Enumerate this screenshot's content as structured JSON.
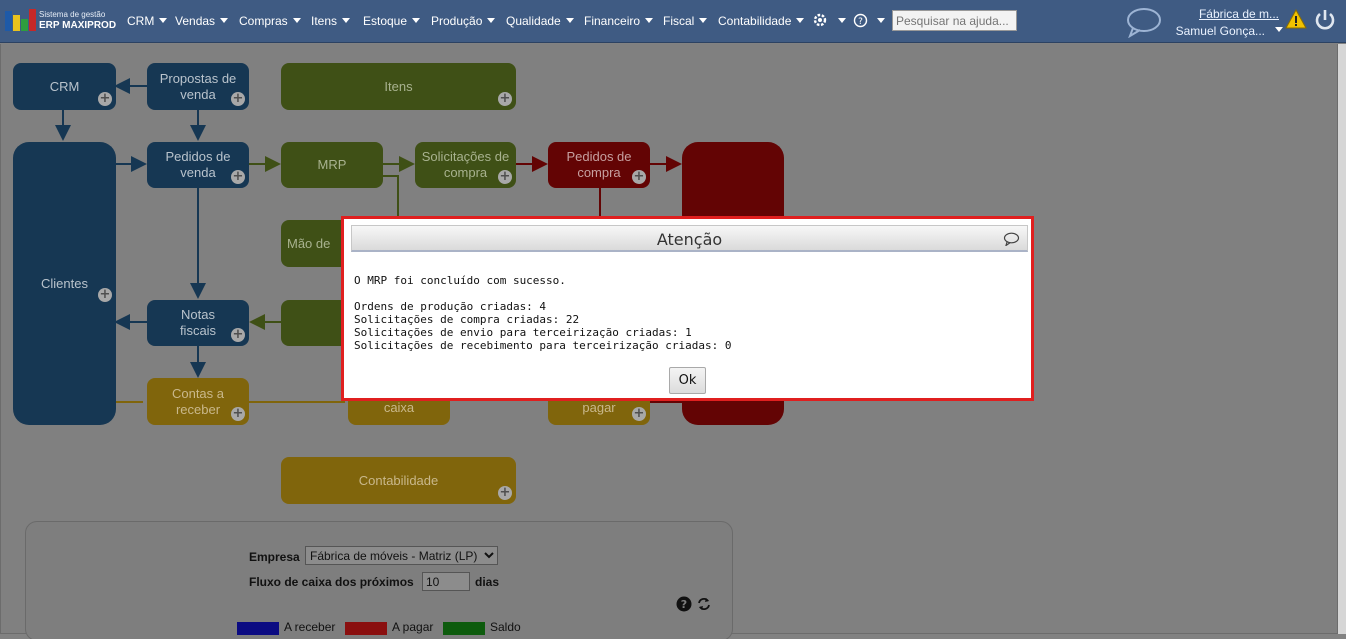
{
  "logo": {
    "line1": "Sistema de gestão",
    "line2": "ERP MAXIPROD"
  },
  "menu": [
    "CRM",
    "Vendas",
    "Compras",
    "Itens",
    "Estoque",
    "Produção",
    "Qualidade",
    "Financeiro",
    "Fiscal",
    "Contabilidade"
  ],
  "search": {
    "placeholder": "Pesquisar na ajuda..."
  },
  "user": {
    "company": "Fábrica de m...",
    "name": "Samuel Gonça..."
  },
  "nodes": {
    "crm": "CRM",
    "propostas": "Propostas de\nvenda",
    "itens": "Itens",
    "clientes": "Clientes",
    "pedidos_venda": "Pedidos de\nvenda",
    "mrp": "MRP",
    "solicitacoes": "Solicitações de\ncompra",
    "pedidos_compra": "Pedidos de\ncompra",
    "mao_obra": "Mão de",
    "notas": "Notas\nfiscais",
    "contas_receber": "Contas a\nreceber",
    "caixa": "caixa",
    "pagar": "pagar",
    "contabilidade": "Contabilidade",
    "plus": "+"
  },
  "cashflow": {
    "empresa_label": "Empresa",
    "empresa_value": "Fábrica de móveis - Matriz (LP)",
    "fluxo_label": "Fluxo de caixa dos próximos",
    "fluxo_days": "10",
    "dias_label": "dias",
    "legend": [
      {
        "label": "A receber",
        "color": "#0b0b82"
      },
      {
        "label": "A pagar",
        "color": "#8a0f0f"
      },
      {
        "label": "Saldo",
        "color": "#0d5b0d"
      }
    ]
  },
  "dialog": {
    "title": "Atenção",
    "message": "O MRP foi concluído com sucesso.",
    "lines": [
      "Ordens de produção criadas: 4",
      "Solicitações de compra criadas: 22",
      "Solicitações de envio para terceirização criadas: 1",
      "Solicitações de recebimento para terceirização criadas: 0"
    ],
    "ok": "Ok"
  }
}
